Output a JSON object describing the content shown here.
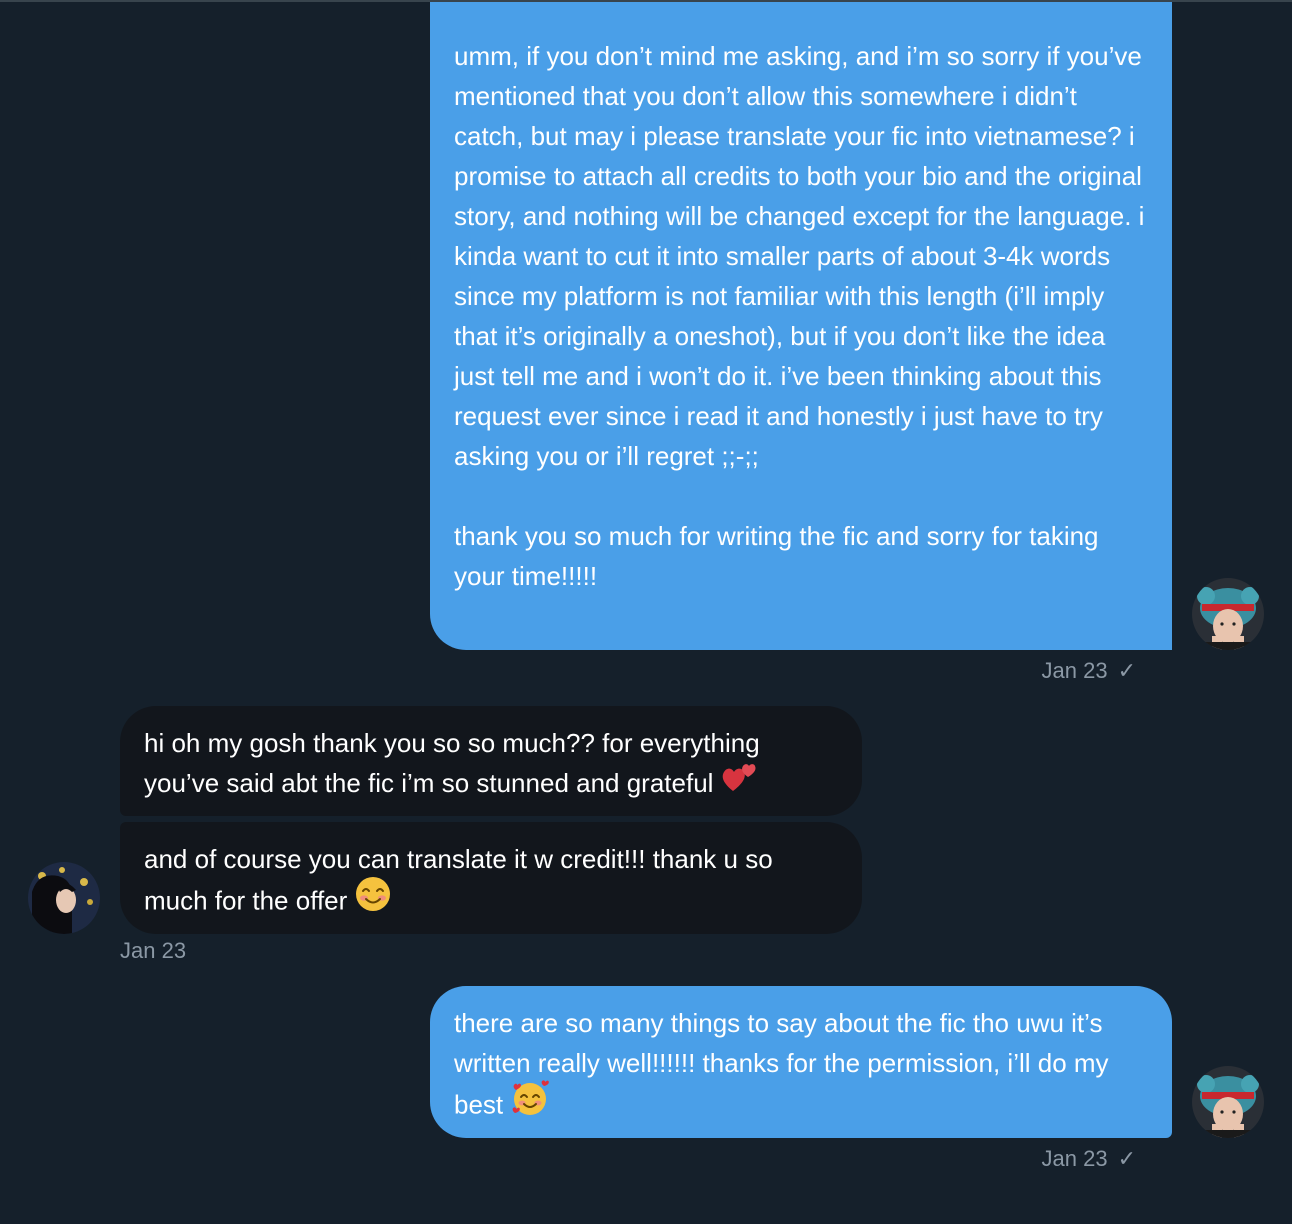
{
  "messages": [
    {
      "id": "msg1",
      "direction": "sent",
      "text": "umm, if you don’t mind me asking, and i’m so sorry if you’ve mentioned that you don’t allow this somewhere i didn’t catch, but may i please translate your fic into vietnamese? i promise to attach all credits to both your bio and the original story, and nothing will be changed except for the language. i kinda want to cut it into smaller parts of about 3-4k words since my platform is not familiar with this length (i’ll imply that it’s originally a oneshot), but if you don’t like the idea just tell me and i won’t do it. i’ve been thinking about this request ever since i read it and honestly i just have to try asking you or i’ll regret ;;-;;\n\nthank you so much for writing the fic and sorry for taking your time!!!!!",
      "timestamp": "Jan 23",
      "status": "✓"
    },
    {
      "id": "msg2",
      "direction": "received",
      "text": "hi oh my gosh thank you so so much?? for everything you’ve said abt the fic i’m so stunned and grateful",
      "emoji": "two-hearts-icon"
    },
    {
      "id": "msg3",
      "direction": "received",
      "text": "and of course you can translate it w credit!!! thank u so much for the offer",
      "emoji": "smiling-face-icon",
      "timestamp": "Jan 23"
    },
    {
      "id": "msg4",
      "direction": "sent",
      "text": "there are so many things to say about the fic tho uwu it’s written really well!!!!!! thanks for the permission, i’ll do my best",
      "emoji": "smiling-face-with-hearts-icon",
      "timestamp": "Jan 23",
      "status": "✓"
    }
  ],
  "colors": {
    "background": "#15202b",
    "sent_bubble": "#4a9fe8",
    "received_bubble": "#12161c",
    "timestamp": "#8b98a5"
  }
}
